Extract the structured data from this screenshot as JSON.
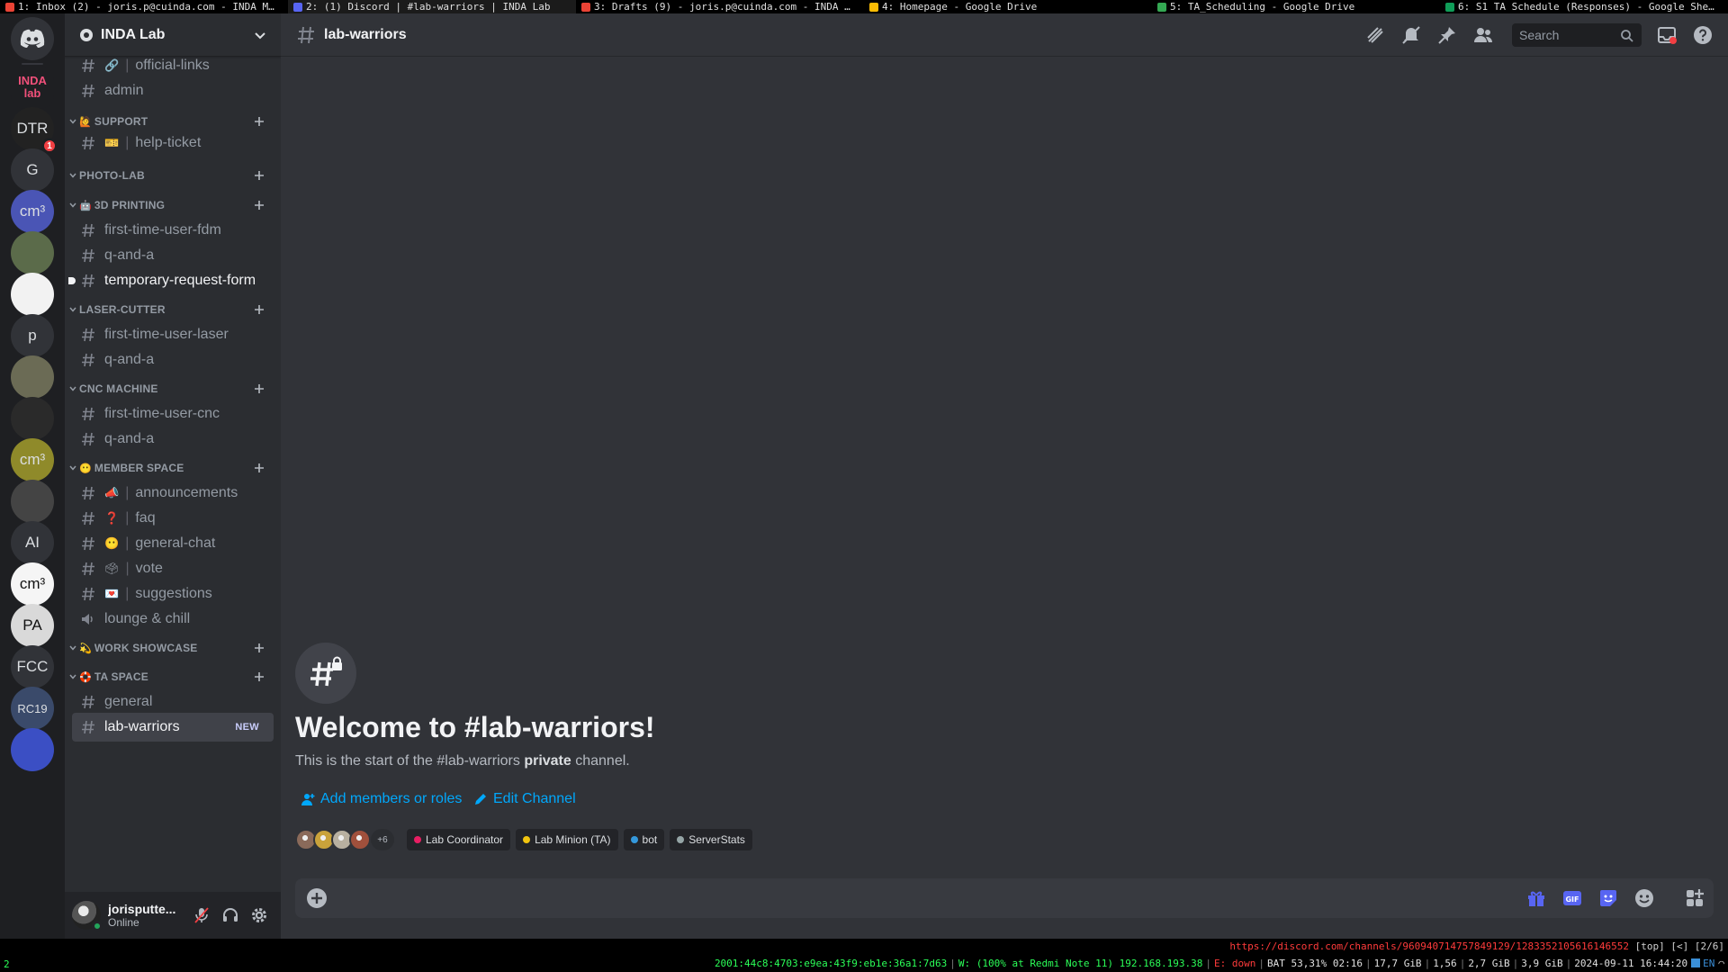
{
  "wm_tabs": [
    {
      "label": "1: Inbox (2) - joris.p@cuinda.com - INDA M…",
      "icon_color": "#ea4335"
    },
    {
      "label": "2: (1) Discord | #lab-warriors | INDA Lab",
      "icon_color": "#5865f2"
    },
    {
      "label": "3: Drafts (9) - joris.p@cuinda.com - INDA …",
      "icon_color": "#ea4335"
    },
    {
      "label": "4: Homepage - Google Drive",
      "icon_color": "#fbbc04"
    },
    {
      "label": "5: TA_Scheduling - Google Drive",
      "icon_color": "#34a853"
    },
    {
      "label": "6: S1 TA Schedule (Responses) - Google She…",
      "icon_color": "#0f9d58"
    }
  ],
  "servers": [
    {
      "name": "discord-home",
      "label": "",
      "icon": "discord-logo-icon",
      "bg": "#313338"
    },
    {
      "name": "inda-lab",
      "label": "INDA lab",
      "bg": "#1e1f22"
    },
    {
      "name": "dtr",
      "label": "DTR",
      "bg": "#222",
      "badge": "1"
    },
    {
      "name": "g",
      "label": "G",
      "bg": "#313338"
    },
    {
      "name": "cm3-blue",
      "label": "cm³",
      "bg": "#4a55b5"
    },
    {
      "name": "camo",
      "label": "",
      "bg": "#5b6b4a"
    },
    {
      "name": "maze",
      "label": "",
      "bg": "#f2f2f2"
    },
    {
      "name": "p",
      "label": "p",
      "bg": "#313338"
    },
    {
      "name": "truck",
      "label": "",
      "bg": "#6b6b55"
    },
    {
      "name": "wolf",
      "label": "",
      "bg": "#2a2a2a"
    },
    {
      "name": "cm3-yellow",
      "label": "cm³",
      "bg": "#8f8a2a"
    },
    {
      "name": "clock",
      "label": "",
      "bg": "#444"
    },
    {
      "name": "ai",
      "label": "AI",
      "bg": "#313338"
    },
    {
      "name": "cm3-white",
      "label": "cm³",
      "bg": "#f5f5f5"
    },
    {
      "name": "pa",
      "label": "PA",
      "bg": "#d9d9d9"
    },
    {
      "name": "fcc",
      "label": "FCC",
      "bg": "#313338"
    },
    {
      "name": "rc19",
      "label": "RC19",
      "bg": "#3a4a6a"
    },
    {
      "name": "swirl",
      "label": "",
      "bg": "#3b4fc4"
    }
  ],
  "guild": {
    "name": "INDA Lab"
  },
  "channels": [
    {
      "type": "channel",
      "label": "official-links",
      "emoji": "🔗"
    },
    {
      "type": "channel",
      "label": "admin"
    },
    {
      "type": "category",
      "label": "SUPPORT",
      "emoji": "🙋"
    },
    {
      "type": "channel",
      "label": "help-ticket",
      "emoji": "🎫"
    },
    {
      "type": "category",
      "label": "PHOTO-LAB"
    },
    {
      "type": "category",
      "label": "3D PRINTING",
      "emoji": "🤖"
    },
    {
      "type": "channel",
      "label": "first-time-user-fdm"
    },
    {
      "type": "channel",
      "label": "q-and-a"
    },
    {
      "type": "channel",
      "label": "temporary-request-form",
      "unread": true
    },
    {
      "type": "category",
      "label": "LASER-CUTTER"
    },
    {
      "type": "channel",
      "label": "first-time-user-laser"
    },
    {
      "type": "channel",
      "label": "q-and-a"
    },
    {
      "type": "category",
      "label": "CNC MACHINE"
    },
    {
      "type": "channel",
      "label": "first-time-user-cnc"
    },
    {
      "type": "channel",
      "label": "q-and-a"
    },
    {
      "type": "category",
      "label": "MEMBER SPACE",
      "emoji": "😶"
    },
    {
      "type": "channel",
      "label": "announcements",
      "emoji": "📣"
    },
    {
      "type": "channel",
      "label": "faq",
      "emoji": "❓"
    },
    {
      "type": "channel",
      "label": "general-chat",
      "emoji": "😶"
    },
    {
      "type": "channel",
      "label": "vote",
      "emoji": "🗳"
    },
    {
      "type": "channel",
      "label": "suggestions",
      "emoji": "💌"
    },
    {
      "type": "voice",
      "label": "lounge & chill"
    },
    {
      "type": "category",
      "label": "WORK SHOWCASE",
      "emoji": "💫"
    },
    {
      "type": "category",
      "label": "TA SPACE",
      "emoji": "🛟"
    },
    {
      "type": "channel",
      "label": "general"
    },
    {
      "type": "channel",
      "label": "lab-warriors",
      "selected": true,
      "badge": "NEW"
    }
  ],
  "user": {
    "name": "jorisputte...",
    "status": "Online"
  },
  "channel_header": {
    "title": "lab-warriors",
    "search_placeholder": "Search"
  },
  "welcome": {
    "title": "Welcome to #lab-warriors!",
    "desc_prefix": "This is the start of the #lab-warriors ",
    "desc_bold": "private",
    "desc_suffix": " channel.",
    "add_members_label": "Add members or roles",
    "edit_channel_label": "Edit Channel"
  },
  "members": {
    "avatars": [
      "#8a6a5a",
      "#c9a23b",
      "#b8b0a0",
      "#a0503c"
    ],
    "more": "+6"
  },
  "roles": [
    {
      "label": "Lab Coordinator",
      "color": "#e91e63"
    },
    {
      "label": "Lab Minion (TA)",
      "color": "#f1c40f"
    },
    {
      "label": "bot",
      "color": "#3498db"
    },
    {
      "label": "ServerStats",
      "color": "#95a5a6"
    }
  ],
  "composer": {
    "placeholder": ""
  },
  "statusbar": {
    "url": "https://discord.com/channels/960940714757849129/1283352105616146552",
    "nav": "[top] [<] [2/6]",
    "workspace": "2",
    "ipv6": "2001:44c8:4703:e9ea:43f9:eb1e:36a1:7d63",
    "wifi": "W: (100% at Redmi Note 11) 192.168.193.38",
    "eth": "E: down",
    "battery": "BAT 53,31% 02:16",
    "disk": "17,7 GiB",
    "load": "1,56",
    "mem": "2,7 GiB",
    "swap": "3,9 GiB",
    "datetime": "2024-09-11 16:44:20",
    "lang": "EN"
  }
}
